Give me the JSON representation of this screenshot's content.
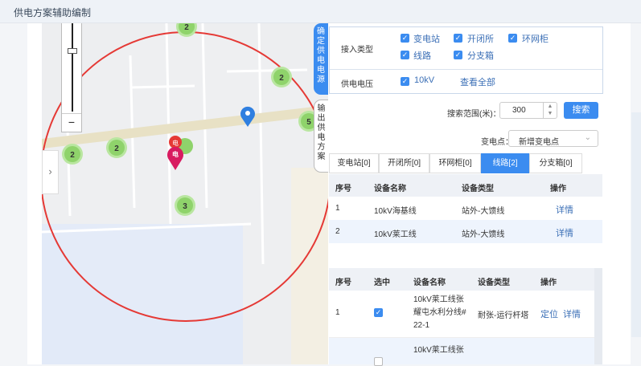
{
  "app": {
    "title": "供电方案辅助编制"
  },
  "map": {
    "zoom_minus": "−",
    "collapse_arrow": "›",
    "clusters": [
      "2",
      "2",
      "5",
      "2",
      "2",
      "3"
    ],
    "marker_labels": [
      "电",
      "电"
    ]
  },
  "side_tabs": {
    "confirm": [
      "确",
      "定",
      "供",
      "电",
      "电",
      "源"
    ],
    "output": [
      "输",
      "出",
      "供",
      "电",
      "方",
      "案"
    ]
  },
  "filters": {
    "access_type_label": "接入类型",
    "access_types": [
      {
        "label": "变电站",
        "checked": true
      },
      {
        "label": "开闭所",
        "checked": true
      },
      {
        "label": "环网柜",
        "checked": true
      },
      {
        "label": "线路",
        "checked": true
      },
      {
        "label": "分支箱",
        "checked": true
      }
    ],
    "voltage_label": "供电电压",
    "voltage_option": {
      "label": "10kV",
      "checked": true
    },
    "view_all": "查看全部"
  },
  "search": {
    "range_label": "搜索范围(米)：",
    "range_value": "300",
    "button": "搜索",
    "station_label": "变电点：",
    "station_value": "新增变电点"
  },
  "type_tabs": [
    "变电站[0]",
    "开闭所[0]",
    "环网柜[0]",
    "线路[2]",
    "分支箱[0]"
  ],
  "lines_table": {
    "headers": [
      "序号",
      "设备名称",
      "设备类型",
      "操作"
    ],
    "rows": [
      {
        "no": "1",
        "name": "10kV海基线",
        "type": "站外-大馈线",
        "op": "详情"
      },
      {
        "no": "2",
        "name": "10kV莱工线",
        "type": "站外-大馈线",
        "op": "详情"
      }
    ]
  },
  "device_table": {
    "headers": [
      "序号",
      "选中",
      "设备名称",
      "设备类型",
      "操作"
    ],
    "rows": [
      {
        "no": "1",
        "checked": true,
        "name_lines": [
          "10kV莱工线张",
          "耀屯水利分线#",
          "22-1"
        ],
        "type": "耐张-运行杆塔",
        "op_locate": "定位",
        "op_detail": "详情"
      },
      {
        "no": "",
        "checked": false,
        "name_lines": [
          "10kV莱工线张"
        ],
        "type": "",
        "op_locate": "",
        "op_detail": ""
      }
    ]
  },
  "colors": {
    "accent": "#3b8cf0",
    "link": "#3b6fb6",
    "circle": "#e53935",
    "cluster": "#8fd36b",
    "marker_red": "#d81b60",
    "marker_blue": "#2f7fe0"
  }
}
